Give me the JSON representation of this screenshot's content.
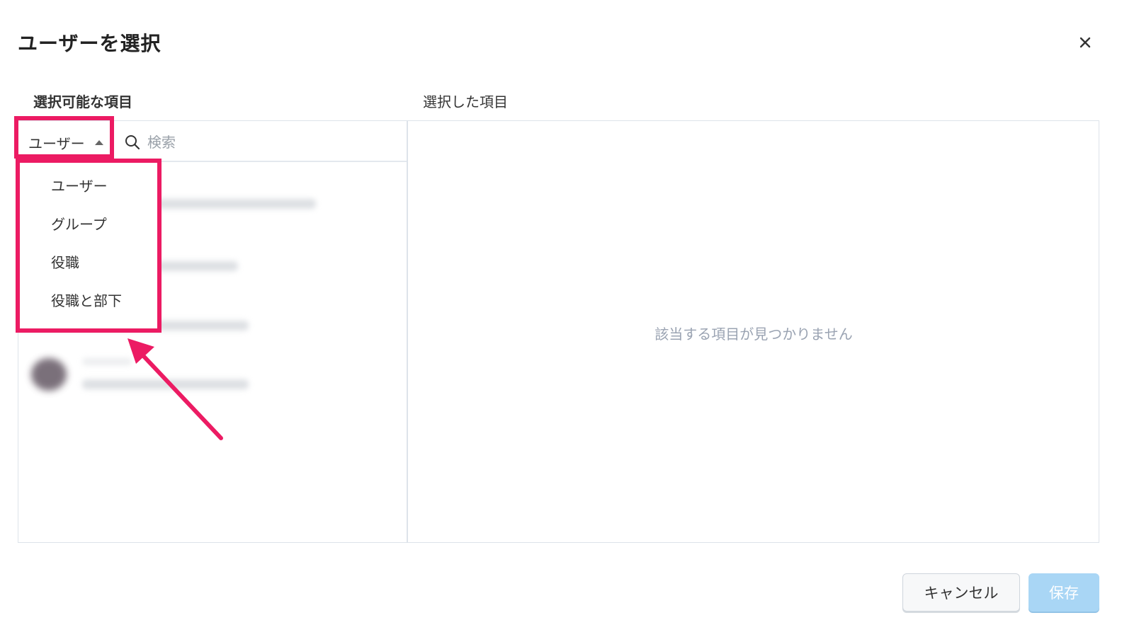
{
  "dialog": {
    "title": "ユーザーを選択",
    "close_icon": "close-icon"
  },
  "available": {
    "label": "選択可能な項目",
    "type_select_value": "ユーザー",
    "search_placeholder": "検索",
    "dropdown_options": [
      "ユーザー",
      "グループ",
      "役職",
      "役職と部下"
    ]
  },
  "selected": {
    "label": "選択した項目",
    "empty_message": "該当する項目が見つかりません"
  },
  "footer": {
    "cancel_label": "キャンセル",
    "save_label": "保存"
  },
  "annotation": {
    "highlight_color": "#ec1b63"
  }
}
